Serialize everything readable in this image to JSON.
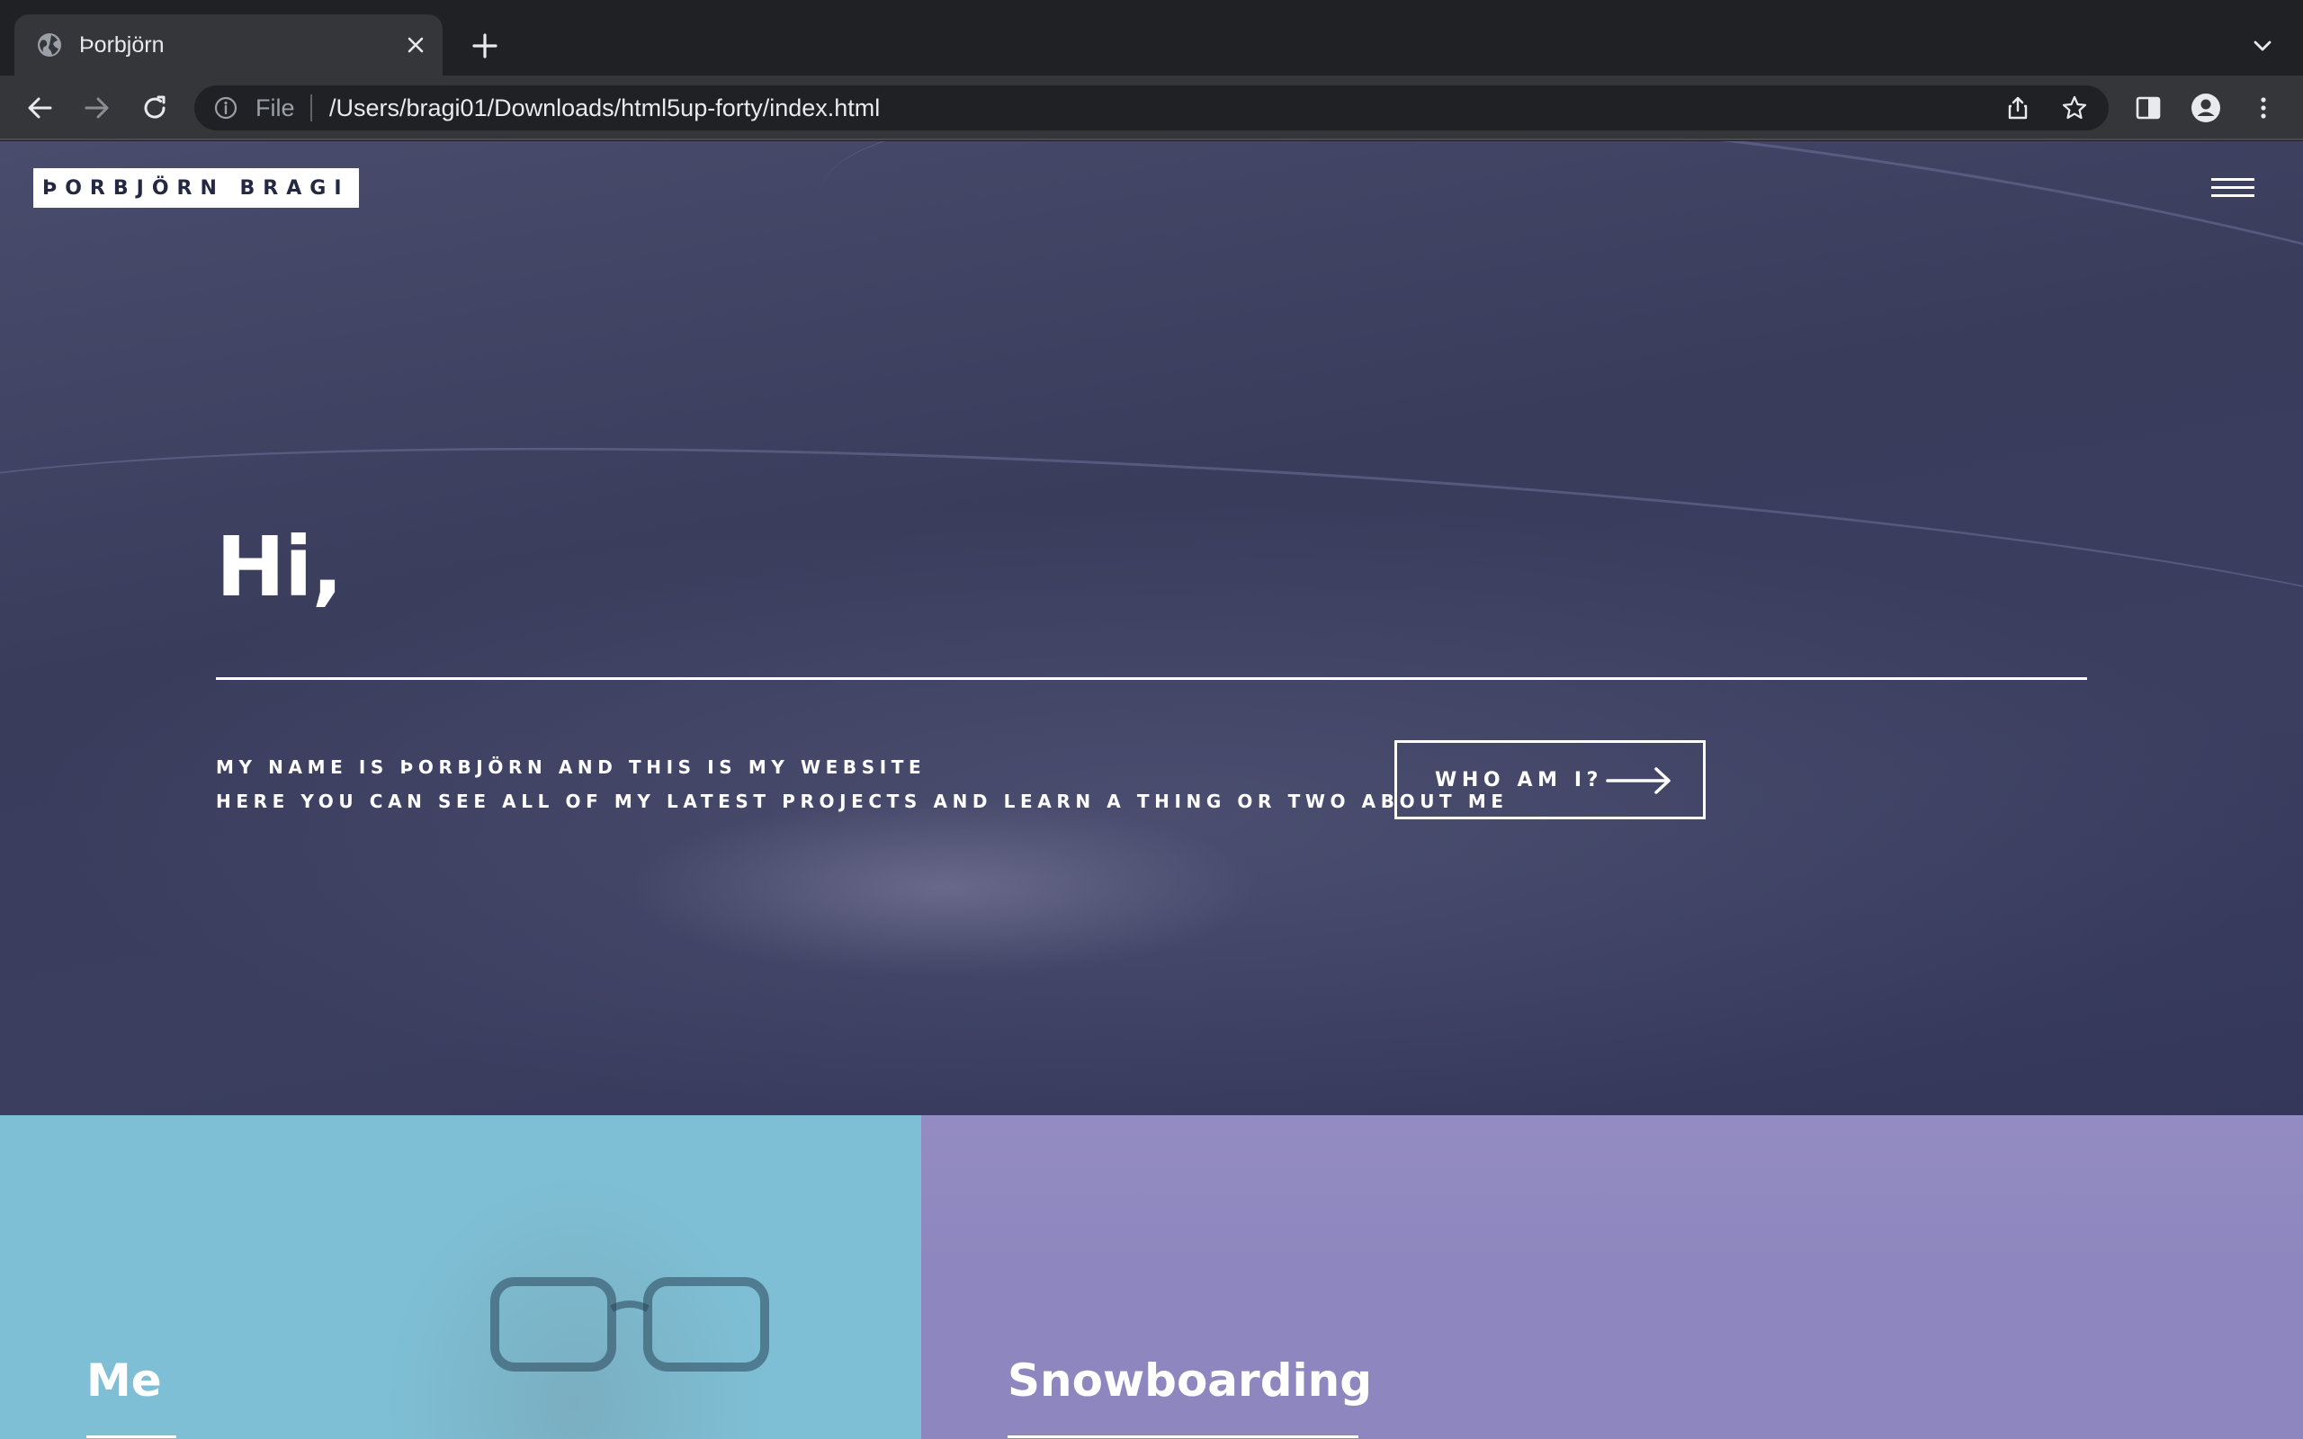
{
  "browser": {
    "tab_title": "Þorbjörn",
    "scheme_label": "File",
    "url": "/Users/bragi01/Downloads/html5up-forty/index.html",
    "icons": [
      "globe-icon",
      "close-icon",
      "plus-icon",
      "chevron-down-icon",
      "back-icon",
      "forward-icon",
      "reload-icon",
      "info-icon",
      "share-icon",
      "star-icon",
      "side-panel-icon",
      "profile-icon",
      "more-icon"
    ]
  },
  "header": {
    "logo": "ÞORBJÖRN BRAGI",
    "menu_icon": "hamburger-icon"
  },
  "banner": {
    "heading": "Hi,",
    "subtitle_line1": "MY NAME IS ÞORBJÖRN AND THIS IS MY WEBSITE",
    "subtitle_line2": "HERE YOU CAN SEE ALL OF MY LATEST PROJECTS AND LEARN A THING OR TWO ABOUT ME",
    "cta_label": "WHO AM I?",
    "cta_icon": "arrow-right-icon"
  },
  "tiles": [
    {
      "title": "Me",
      "color": "#7ebfd5"
    },
    {
      "title": "Snowboarding",
      "color": "#8e87bf"
    }
  ],
  "colors": {
    "banner_overlay": "#3c3f60",
    "logo_text": "#242943",
    "chrome_bg": "#202124",
    "chrome_toolbar": "#35363a"
  }
}
